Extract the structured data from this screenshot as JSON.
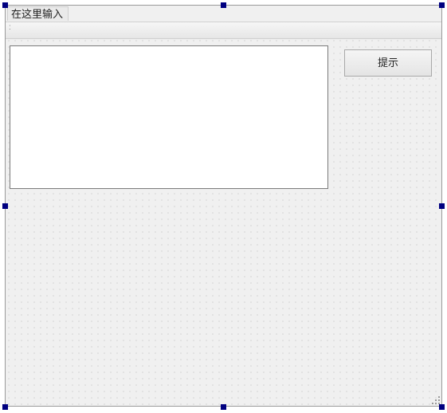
{
  "panel": {
    "tab_label": "在这里输入",
    "toolbar_overflow_glyph": ":"
  },
  "text_area": {
    "value": ""
  },
  "button": {
    "hint_label": "提示"
  }
}
